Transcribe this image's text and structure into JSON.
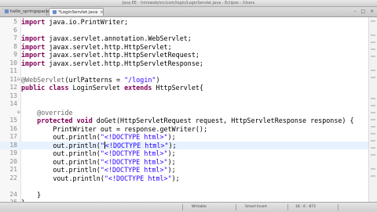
{
  "window": {
    "title": "Java EE - Introweb/src/com/login/LoginServlet.java - Eclipse - /Users"
  },
  "tabs": [
    {
      "label": "hello_springspace.xml",
      "active": false
    },
    {
      "label": "*LoginServlet.java",
      "active": true
    }
  ],
  "window_buttons": {
    "minimize": "–",
    "maximize": "□",
    "close": "×"
  },
  "editor": {
    "current_line": 18,
    "lines": [
      {
        "num": "5",
        "marker": "",
        "tokens": [
          {
            "t": "import",
            "c": "kw"
          },
          {
            "t": " java.io.PrintWriter;"
          }
        ]
      },
      {
        "num": "6",
        "marker": "",
        "tokens": []
      },
      {
        "num": "7",
        "marker": "",
        "tokens": [
          {
            "t": "import",
            "c": "kw"
          },
          {
            "t": " javax.servlet.annotation.WebServlet;"
          }
        ]
      },
      {
        "num": "8",
        "marker": "",
        "tokens": [
          {
            "t": "import",
            "c": "kw"
          },
          {
            "t": " javax.servlet.http.HttpServlet;"
          }
        ]
      },
      {
        "num": "9",
        "marker": "",
        "tokens": [
          {
            "t": "import",
            "c": "kw"
          },
          {
            "t": " javax.servlet.http.HttpServletRequest;"
          }
        ]
      },
      {
        "num": "10",
        "marker": "",
        "tokens": [
          {
            "t": "import",
            "c": "kw"
          },
          {
            "t": " javax.servlet.http.HttpServletResponse;"
          }
        ]
      },
      {
        "num": "11",
        "marker": "",
        "tokens": []
      },
      {
        "num": "11",
        "marker": "⊖",
        "tokens": [
          {
            "t": "@WebServlet",
            "c": "ann"
          },
          {
            "t": "(urlPatterns = "
          },
          {
            "t": "\"/login\"",
            "c": "str"
          },
          {
            "t": ")"
          }
        ]
      },
      {
        "num": "12",
        "marker": "",
        "tokens": [
          {
            "t": "public class",
            "c": "kw"
          },
          {
            "t": " LoginServlet "
          },
          {
            "t": "extends",
            "c": "kw"
          },
          {
            "t": " HttpServlet{"
          }
        ]
      },
      {
        "num": "13",
        "marker": "",
        "tokens": []
      },
      {
        "num": "14",
        "marker": "",
        "tokens": []
      },
      {
        "num": "",
        "marker": "⊖",
        "tokens": [
          {
            "t": "    @override",
            "c": "ann"
          }
        ]
      },
      {
        "num": "15",
        "marker": "",
        "tokens": [
          {
            "t": "    "
          },
          {
            "t": "protected void",
            "c": "kw"
          },
          {
            "t": " doGet(HttpServletRequest request, HttpServletResponse response) {"
          }
        ]
      },
      {
        "num": "16",
        "marker": "",
        "tokens": [
          {
            "t": "        PrintWriter out = response.getWriter();"
          }
        ]
      },
      {
        "num": "17",
        "marker": "",
        "tokens": [
          {
            "t": "        out.println("
          },
          {
            "t": "\"<!DOCTYPE html>\"",
            "c": "str"
          },
          {
            "t": ");"
          }
        ]
      },
      {
        "num": "18",
        "marker": "",
        "tokens": [
          {
            "t": "        out.println("
          },
          {
            "t": "\"",
            "c": "str"
          },
          {
            "t": "|",
            "c": "caret"
          },
          {
            "t": "<!DOCTYPE html>\"",
            "c": "str"
          },
          {
            "t": ");"
          }
        ]
      },
      {
        "num": "19",
        "marker": "",
        "tokens": [
          {
            "t": "        out.println("
          },
          {
            "t": "\"<!DOCTYPE html>\"",
            "c": "str"
          },
          {
            "t": ");"
          }
        ]
      },
      {
        "num": "20",
        "marker": "",
        "tokens": [
          {
            "t": "        out.println("
          },
          {
            "t": "\"<!DOCTYPE html>\"",
            "c": "str"
          },
          {
            "t": ");"
          }
        ]
      },
      {
        "num": "21",
        "marker": "",
        "tokens": [
          {
            "t": "        out.println("
          },
          {
            "t": "\"<!DOCTYPE html>\"",
            "c": "str"
          },
          {
            "t": ");"
          }
        ]
      },
      {
        "num": "22",
        "marker": "",
        "tokens": [
          {
            "t": "        vout.println("
          },
          {
            "t": "\"<!DOCTYPE html>\"",
            "c": "str"
          },
          {
            "t": ");"
          }
        ]
      },
      {
        "num": "",
        "marker": "",
        "tokens": []
      },
      {
        "num": "24",
        "marker": "",
        "tokens": [
          {
            "t": "    }"
          }
        ]
      },
      {
        "num": "25",
        "marker": "",
        "tokens": [
          {
            "t": "}"
          }
        ]
      },
      {
        "num": "26",
        "marker": "",
        "tokens": []
      }
    ]
  },
  "statusbar": {
    "writable": "Writable",
    "insert_mode": "Smart Insert",
    "position": "18 : 6 : 872"
  }
}
